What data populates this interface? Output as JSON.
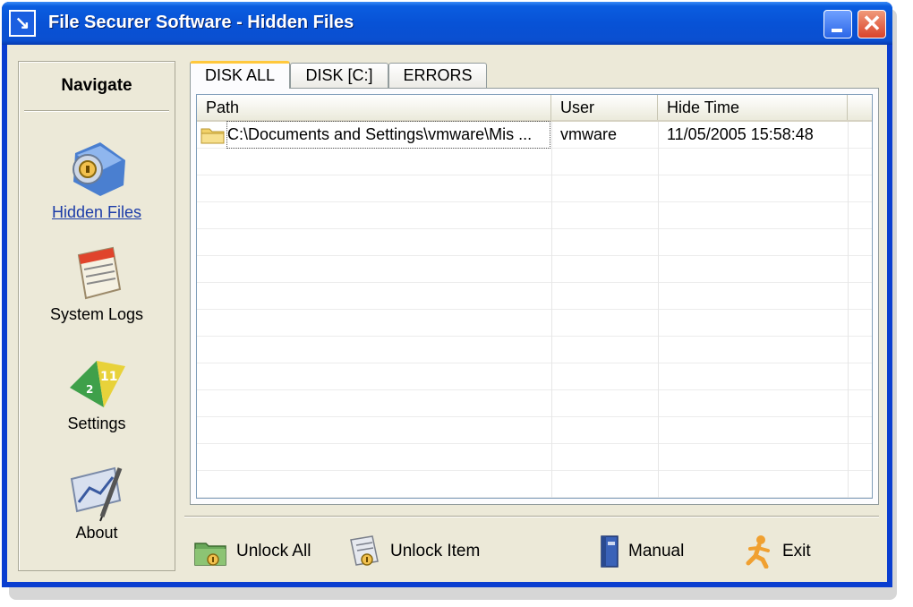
{
  "window": {
    "title": "File Securer Software - Hidden Files",
    "close_glyph": "✕"
  },
  "sidebar": {
    "title": "Navigate",
    "items": [
      {
        "label": "Hidden Files",
        "icon": "hidden-files-icon",
        "active": true
      },
      {
        "label": "System Logs",
        "icon": "system-logs-icon",
        "active": false
      },
      {
        "label": "Settings",
        "icon": "settings-icon",
        "active": false
      },
      {
        "label": "About",
        "icon": "about-icon",
        "active": false
      }
    ]
  },
  "tabs": [
    {
      "label": "DISK ALL",
      "active": true
    },
    {
      "label": "DISK [C:]",
      "active": false
    },
    {
      "label": "ERRORS",
      "active": false
    }
  ],
  "table": {
    "columns": [
      "Path",
      "User",
      "Hide Time"
    ],
    "rows": [
      {
        "path": "C:\\Documents and Settings\\vmware\\Mis ...",
        "user": "vmware",
        "hide_time": "11/05/2005 15:58:48"
      }
    ]
  },
  "actions": {
    "unlock_all": "Unlock All",
    "unlock_item": "Unlock Item",
    "manual": "Manual",
    "exit": "Exit"
  },
  "colors": {
    "title_bar": "#0852d6",
    "client_bg": "#ece9d8",
    "active_tab_accent": "#ffc83c",
    "link": "#1c3ca8"
  }
}
